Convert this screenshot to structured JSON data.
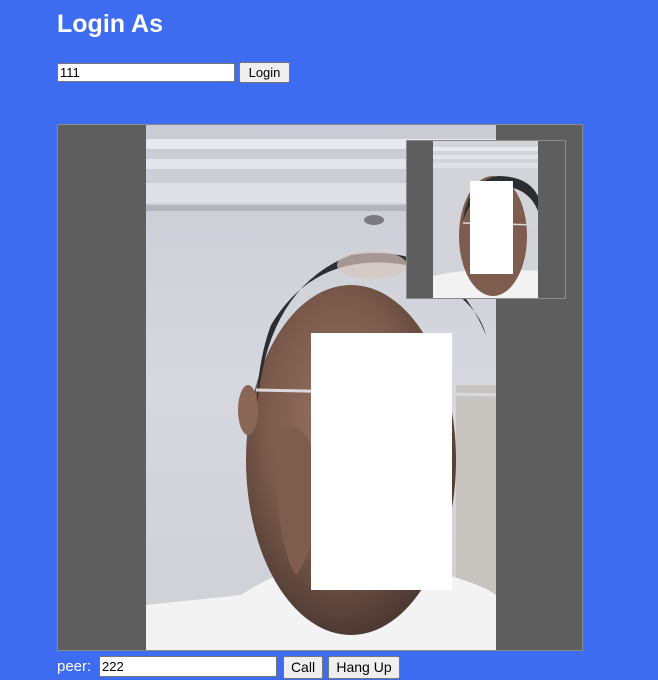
{
  "header": {
    "title": "Login As"
  },
  "login": {
    "username_value": "111",
    "button_label": "Login"
  },
  "call": {
    "peer_label": "peer:",
    "peer_value": "222",
    "call_label": "Call",
    "hangup_label": "Hang Up"
  },
  "colors": {
    "background": "#3d6cf0",
    "video_frame": "#5e5e5e"
  }
}
